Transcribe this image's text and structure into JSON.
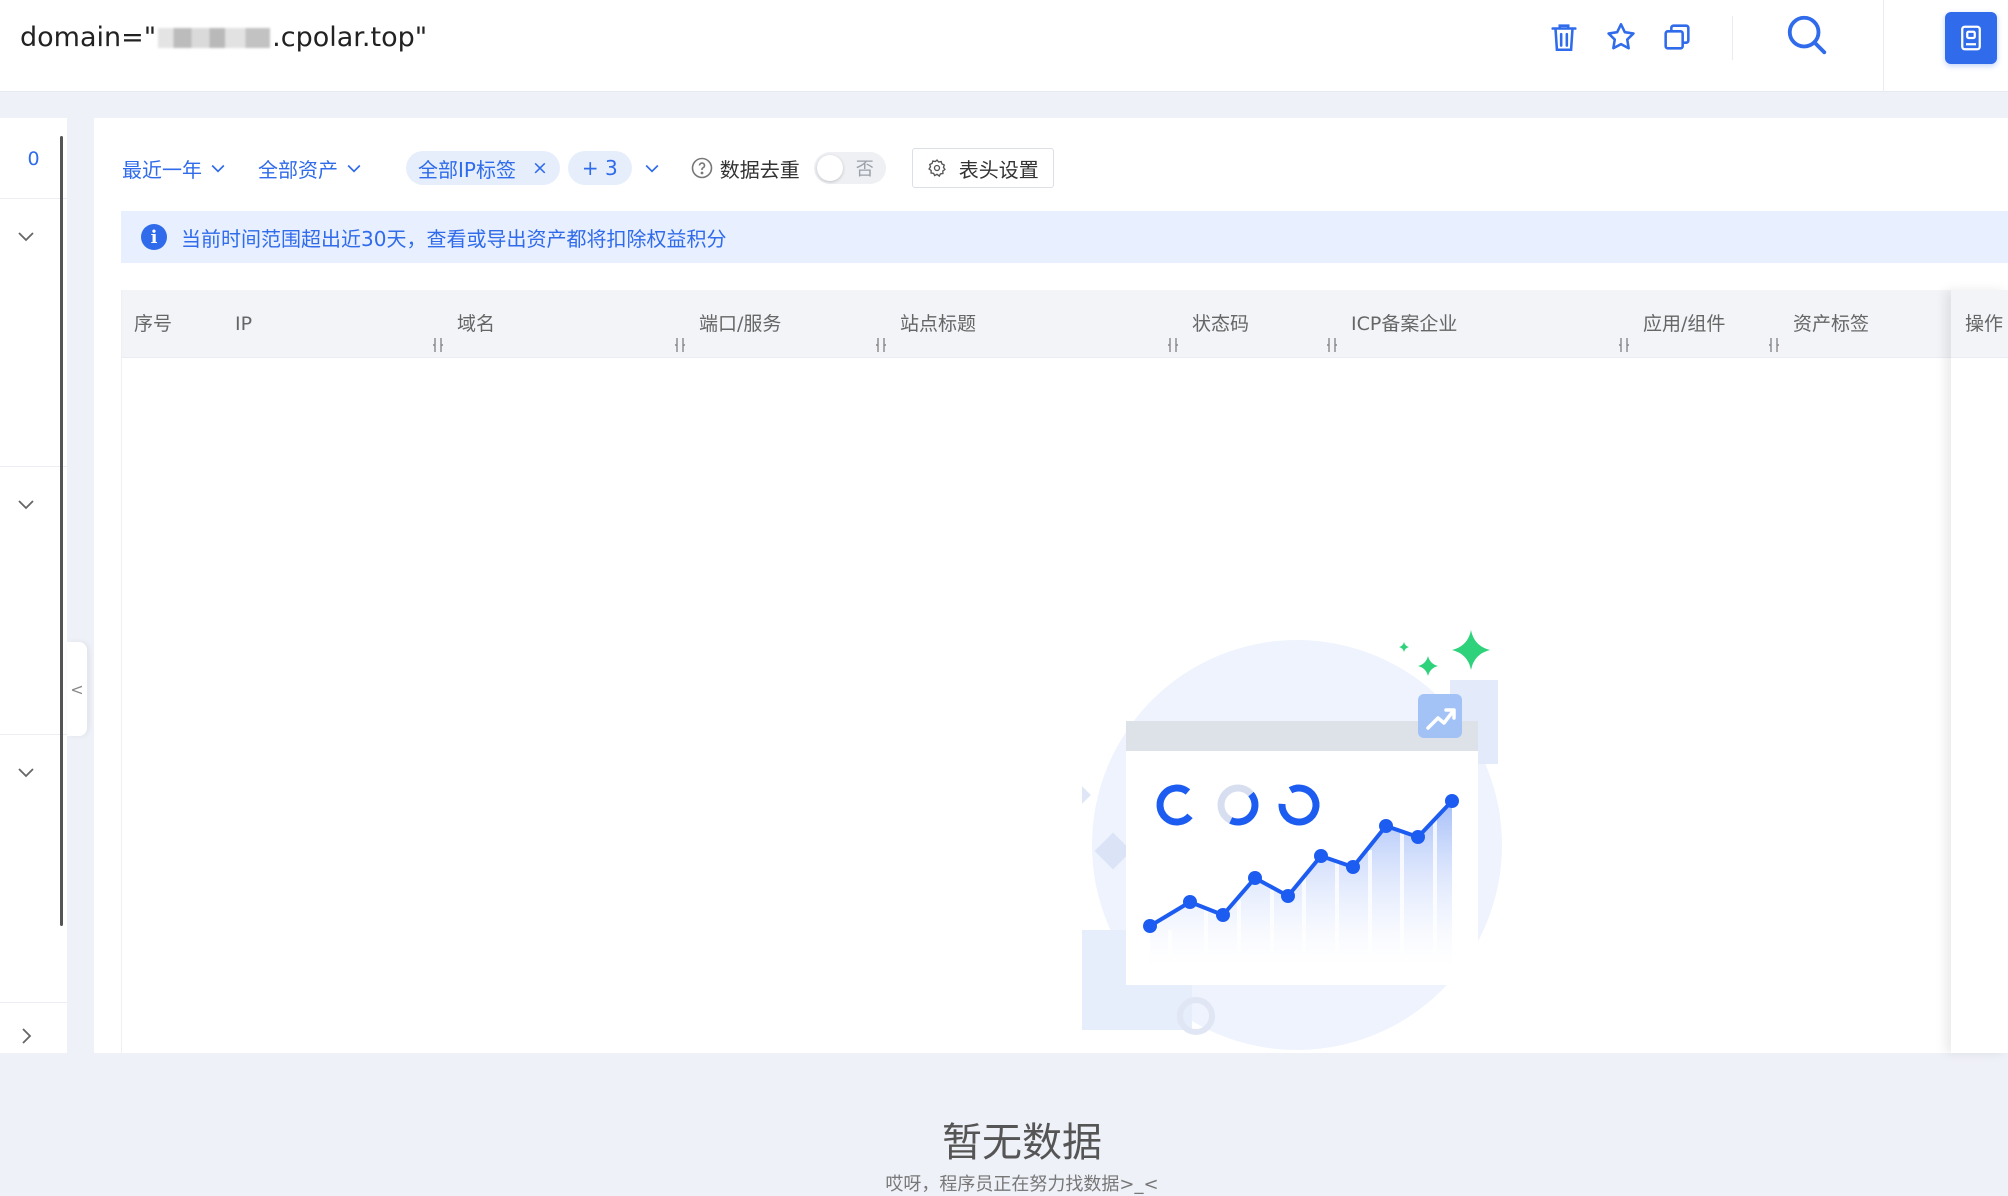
{
  "search": {
    "query_prefix": "domain=\"",
    "query_suffix": ".cpolar.top\""
  },
  "toolbar": {
    "icons": [
      "trash-icon",
      "star-icon",
      "copy-icon",
      "search-icon",
      "book-icon"
    ]
  },
  "left_panel": {
    "count": "0",
    "collapse_label": "<"
  },
  "filters": {
    "time_range": "最近一年",
    "asset_scope": "全部资产",
    "ip_tag": "全部IP标签",
    "ip_tag_remove": "×",
    "more_count": "+ 3",
    "dedupe_label": "数据去重",
    "dedupe_value": "否",
    "header_settings": "表头设置"
  },
  "notice": {
    "icon_text": "i",
    "text": "当前时间范围超出近30天，查看或导出资产都将扣除权益积分"
  },
  "table": {
    "columns": [
      "序号",
      "IP",
      "域名",
      "端口/服务",
      "站点标题",
      "状态码",
      "ICP备案企业",
      "应用/组件",
      "资产标签",
      "操作"
    ]
  },
  "empty": {
    "title": "暂无数据",
    "subtitle": "哎呀，程序员正在努力找数据>_<"
  },
  "colors": {
    "accent": "#2f6bea",
    "notice_bg": "#e8efff",
    "sparkle": "#2ed27a"
  }
}
